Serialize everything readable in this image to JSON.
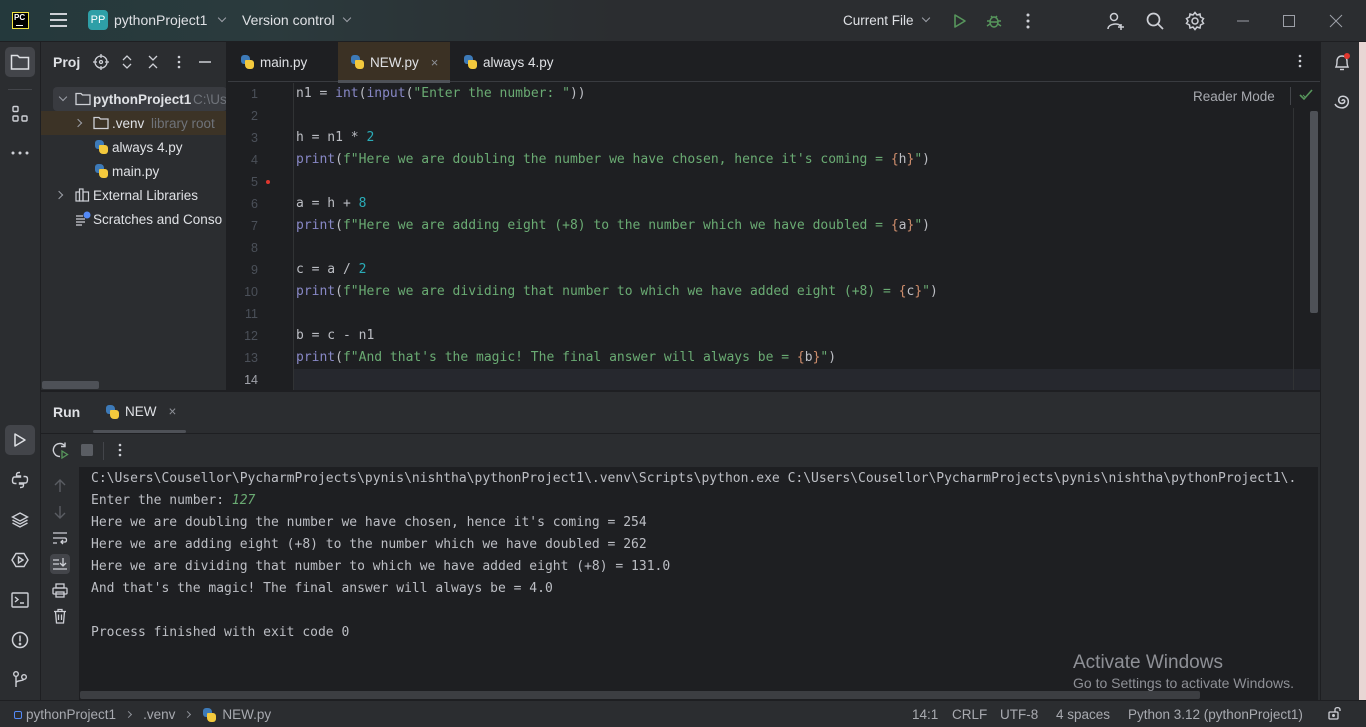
{
  "titlebar": {
    "logo_text": "PC",
    "project_badge": "PP",
    "project_name": "pythonProject1",
    "version_control": "Version control",
    "run_config": "Current File"
  },
  "project_panel": {
    "title": "Proj",
    "tree": [
      {
        "label": "pythonProject1",
        "hint": "C:\\Us",
        "type": "folder",
        "expanded": true
      },
      {
        "label": ".venv",
        "hint": "library root",
        "type": "folder",
        "expanded": false
      },
      {
        "label": "always 4.py",
        "type": "python-file"
      },
      {
        "label": "main.py",
        "type": "python-file"
      },
      {
        "label": "External Libraries",
        "type": "libraries",
        "expanded": false
      },
      {
        "label": "Scratches and Conso",
        "type": "scratches"
      }
    ]
  },
  "editor": {
    "tabs": [
      {
        "label": "main.py",
        "active": false
      },
      {
        "label": "NEW.py",
        "active": true,
        "close": "×"
      },
      {
        "label": "always 4.py",
        "active": false
      }
    ],
    "reader_mode": "Reader Mode",
    "line_numbers": [
      "1",
      "2",
      "3",
      "4",
      "5",
      "6",
      "7",
      "8",
      "9",
      "10",
      "11",
      "12",
      "13",
      "14"
    ],
    "current_line": 14,
    "breakpoint_line": 5,
    "code": {
      "l1": {
        "a": "n1 = ",
        "b": "int",
        "c": "(",
        "d": "input",
        "e": "(",
        "f": "\"Enter the number: \"",
        "g": "))"
      },
      "l3": {
        "a": "h = n1 * ",
        "b": "2"
      },
      "l4": {
        "a": "print",
        "b": "(",
        "c": "f\"Here we are doubling the number we have chosen, hence it's coming = ",
        "d": "{",
        "e": "h",
        "f": "}",
        "g": "\"",
        "h": ")"
      },
      "l6": {
        "a": "a = h + ",
        "b": "8"
      },
      "l7": {
        "a": "print",
        "b": "(",
        "c": "f\"Here we are adding eight (+8) to the number which we have doubled = ",
        "d": "{",
        "e": "a",
        "f": "}",
        "g": "\"",
        "h": ")"
      },
      "l9": {
        "a": "c = a / ",
        "b": "2"
      },
      "l10": {
        "a": "print",
        "b": "(",
        "c": "f\"Here we are dividing that number to which we have added eight (+8) = ",
        "d": "{",
        "e": "c",
        "f": "}",
        "g": "\"",
        "h": ")"
      },
      "l12": {
        "a": "b = c - n1"
      },
      "l13": {
        "a": "print",
        "b": "(",
        "c": "f\"And that's the magic! The final answer will always be = ",
        "d": "{",
        "e": "b",
        "f": "}",
        "g": "\"",
        "h": ")"
      }
    }
  },
  "run_panel": {
    "title": "Run",
    "tab_label": "NEW",
    "tab_close": "×",
    "console": {
      "command": "C:\\Users\\Cousellor\\PycharmProjects\\pynis\\nishtha\\pythonProject1\\.venv\\Scripts\\python.exe C:\\Users\\Cousellor\\PycharmProjects\\pynis\\nishtha\\pythonProject1\\.",
      "prompt": "Enter the number: ",
      "user_input": "127",
      "out1": "Here we are doubling the number we have chosen, hence it's coming = 254",
      "out2": "Here we are adding eight (+8) to the number which we have doubled = 262",
      "out3": "Here we are dividing that number to which we have added eight (+8) = 131.0",
      "out4": "And that's the magic! The final answer will always be = 4.0",
      "exit": "Process finished with exit code 0"
    }
  },
  "watermark": {
    "line1": "Activate Windows",
    "line2": "Go to Settings to activate Windows."
  },
  "statusbar": {
    "breadcrumb": [
      "pythonProject1",
      ".venv",
      "NEW.py"
    ],
    "position": "14:1",
    "line_ending": "CRLF",
    "encoding": "UTF-8",
    "indent": "4 spaces",
    "interpreter": "Python 3.12 (pythonProject1)"
  },
  "colors": {
    "accent_green": "#57965c",
    "string": "#6aab73",
    "number": "#2aacb8",
    "builtin": "#8888c6",
    "brace": "#cf8e6d",
    "breakpoint": "#e0372e"
  }
}
